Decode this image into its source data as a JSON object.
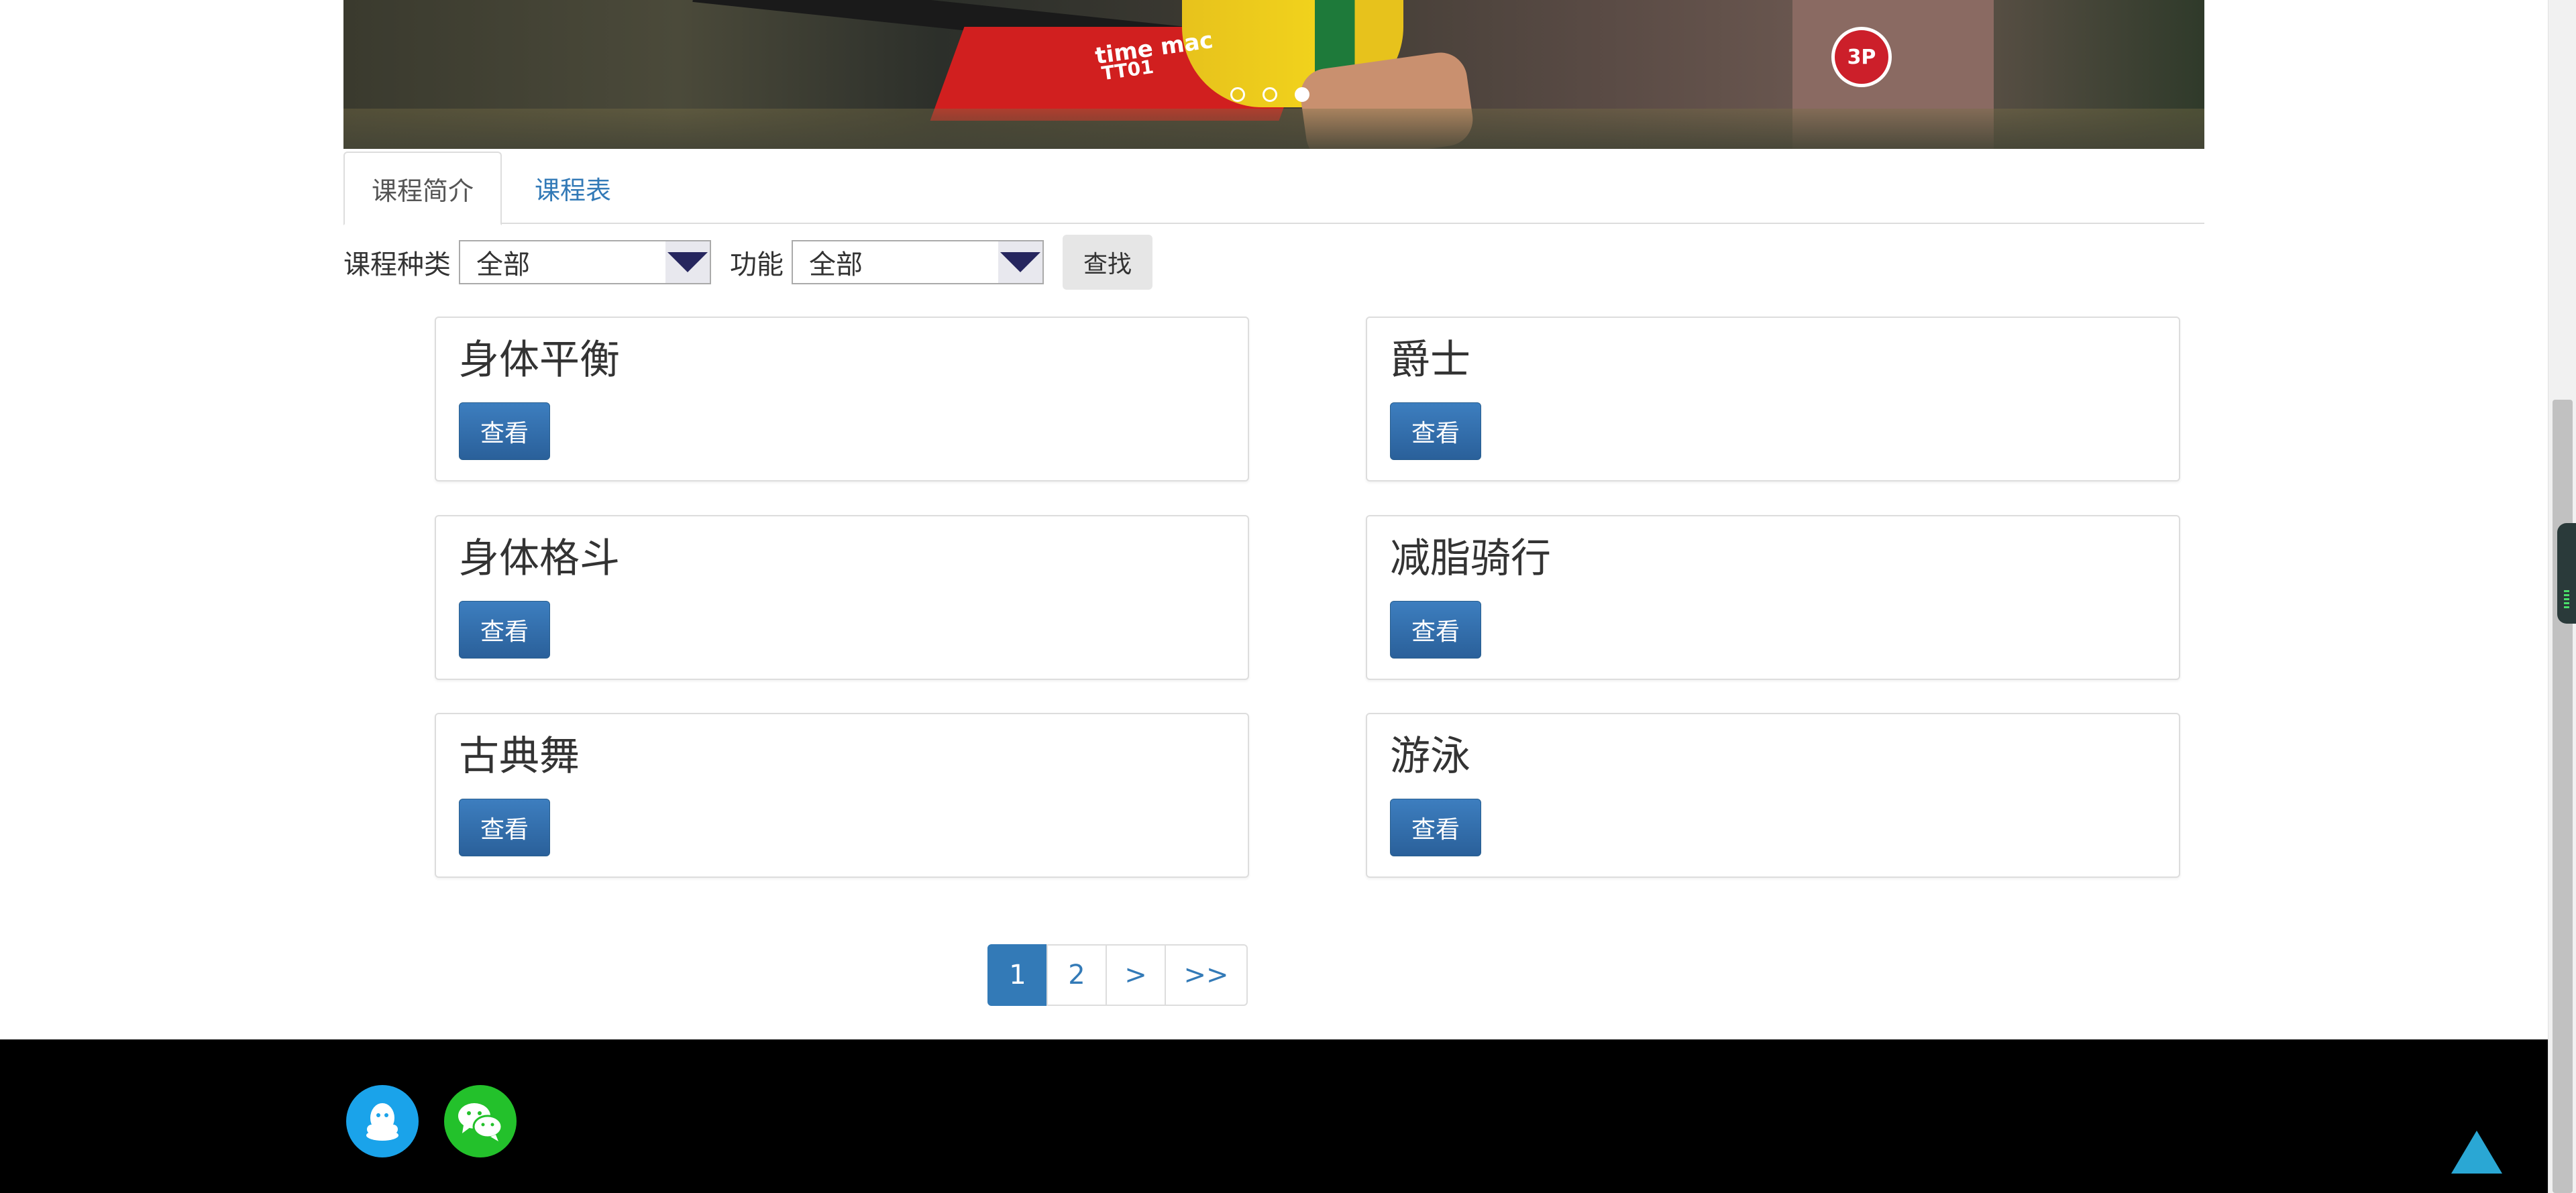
{
  "carousel": {
    "slide_count": 3,
    "active_index": 2,
    "banner_text": [
      "time mac",
      "TT01"
    ],
    "badge_text": "3P"
  },
  "tabs": [
    {
      "label": "课程简介",
      "active": true
    },
    {
      "label": "课程表",
      "active": false
    }
  ],
  "filters": {
    "category_label": "课程种类",
    "category_value": "全部",
    "function_label": "功能",
    "function_value": "全部",
    "search_label": "查找"
  },
  "courses": [
    {
      "title": "身体平衡",
      "button": "查看"
    },
    {
      "title": "爵士",
      "button": "查看"
    },
    {
      "title": "身体格斗",
      "button": "查看"
    },
    {
      "title": "减脂骑行",
      "button": "查看"
    },
    {
      "title": "古典舞",
      "button": "查看"
    },
    {
      "title": "游泳",
      "button": "查看"
    }
  ],
  "pagination": {
    "items": [
      "1",
      "2",
      ">",
      ">>"
    ],
    "active": "1"
  },
  "footer": {
    "icons": [
      "qq-icon",
      "wechat-icon"
    ]
  },
  "colors": {
    "primary": "#337ab7",
    "button": "#2a609a",
    "qq": "#1aa3ea",
    "wechat": "#23c12b",
    "back_to_top": "#2aa7d4",
    "footer": "#000000"
  }
}
